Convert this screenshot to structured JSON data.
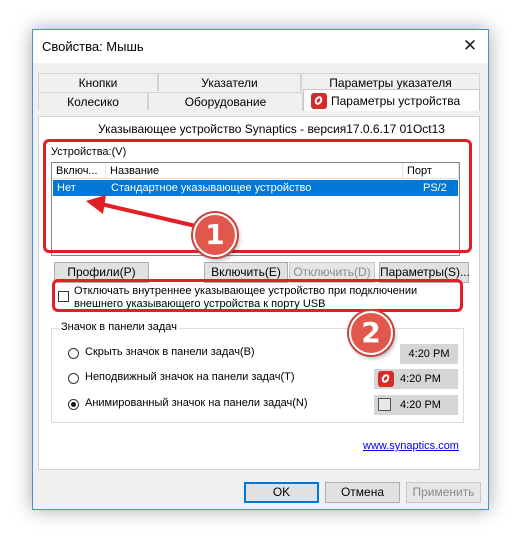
{
  "window": {
    "title": "Свойства: Мышь"
  },
  "tabs_row1": [
    "Кнопки",
    "Указатели",
    "Параметры указателя"
  ],
  "tabs_row2": [
    "Колесико",
    "Оборудование",
    "Параметры устройства"
  ],
  "device_version": "Указывающее устройство Synaptics - версия17.0.6.17 01Oct13",
  "devices": {
    "label": "Устройства:(V)",
    "columns": [
      "Включ...",
      "Название",
      "Порт"
    ],
    "rows": [
      {
        "enabled": "Нет",
        "name": "Стандартное указывающее устройство",
        "port": "PS/2"
      }
    ]
  },
  "buttons": {
    "profiles": "Профили(P)",
    "enable": "Включить(E)",
    "disable": "Отключить(D)",
    "settings": "Параметры(S)..."
  },
  "disable_internal": {
    "line1": "Отключать внутреннее указывающее устройство при подключении",
    "line2": "внешнего указывающего устройства к порту USB",
    "checked": false
  },
  "tray": {
    "label": "Значок в панели задач",
    "options": [
      {
        "label": "Скрыть значок в панели задач(B)",
        "time": "4:20 PM",
        "selected": false
      },
      {
        "label": "Неподвижный значок на панели задач(T)",
        "time": "4:20 PM",
        "selected": false
      },
      {
        "label": "Анимированный значок на панели задач(N)",
        "time": "4:20 PM",
        "selected": true
      }
    ]
  },
  "link": "www.synaptics.com",
  "footer": {
    "ok": "OK",
    "cancel": "Отмена",
    "apply": "Применить"
  },
  "annotations": {
    "one": "1",
    "two": "2"
  },
  "colors": {
    "accent": "#0078d7",
    "annotation_red": "#e31e24",
    "synaptics_red": "#d62b2b"
  }
}
